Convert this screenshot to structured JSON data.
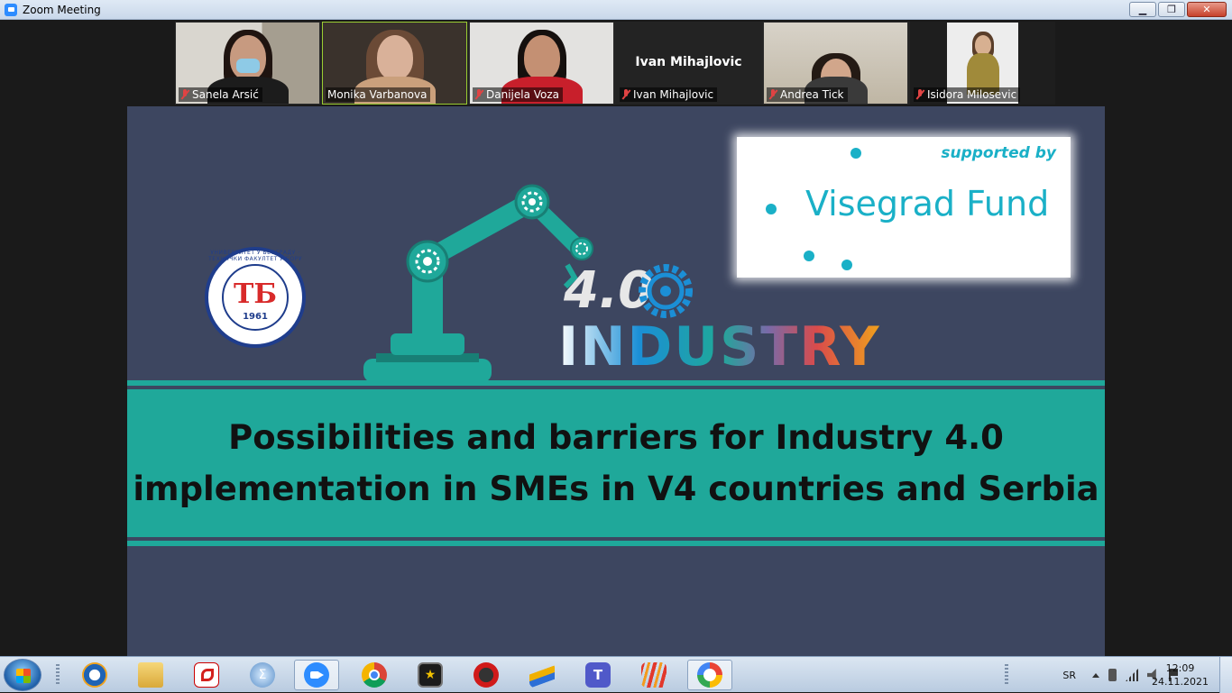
{
  "window": {
    "title": "Zoom Meeting",
    "minimize": "▁",
    "maximize": "❐",
    "close": "✕"
  },
  "participants": [
    {
      "name": "Sanela Arsić",
      "muted": true,
      "video": true
    },
    {
      "name": "Monika Varbanova",
      "muted": false,
      "video": true,
      "speaking": true
    },
    {
      "name": "Danijela Voza",
      "muted": true,
      "video": true
    },
    {
      "name": "Ivan Mihajlovic",
      "muted": true,
      "video": false,
      "display_name": "Ivan Mihajlovic"
    },
    {
      "name": "Andrea Tick",
      "muted": true,
      "video": true
    },
    {
      "name": "Isidora Milosevic",
      "muted": true,
      "video": true
    }
  ],
  "slide": {
    "supported_by": "supported by",
    "fund_name": "Visegrad Fund",
    "seal": {
      "monogram": "ТБ",
      "year": "1961",
      "ring_text": "УНИВЕРЗИТЕТ У БЕОГРАДУ · ТЕХНИЧКИ ФАКУЛТЕТ У БОРУ"
    },
    "industry_number": "4.0",
    "industry_word": "INDUSTRY",
    "title_line_1": "Possibilities and barriers for Industry 4.0",
    "title_line_2": "implementation in SMEs in V4 countries and Serbia",
    "colors": {
      "background": "#3d4660",
      "band": "#1fa89a",
      "accent": "#1ab0c7"
    }
  },
  "taskbar": {
    "apps": [
      {
        "name": "ccleaner-icon"
      },
      {
        "name": "file-explorer-icon"
      },
      {
        "name": "acrobat-icon"
      },
      {
        "name": "math-input-icon"
      },
      {
        "name": "zoom-icon",
        "active": true
      },
      {
        "name": "chrome-icon"
      },
      {
        "name": "movie-icon"
      },
      {
        "name": "game-icon"
      },
      {
        "name": "sticky-pen-icon"
      },
      {
        "name": "teams-icon"
      },
      {
        "name": "stripes-app-icon"
      },
      {
        "name": "browser-shield-icon",
        "active": true
      }
    ],
    "language": "SR",
    "time": "12:09",
    "date": "24.11.2021"
  }
}
